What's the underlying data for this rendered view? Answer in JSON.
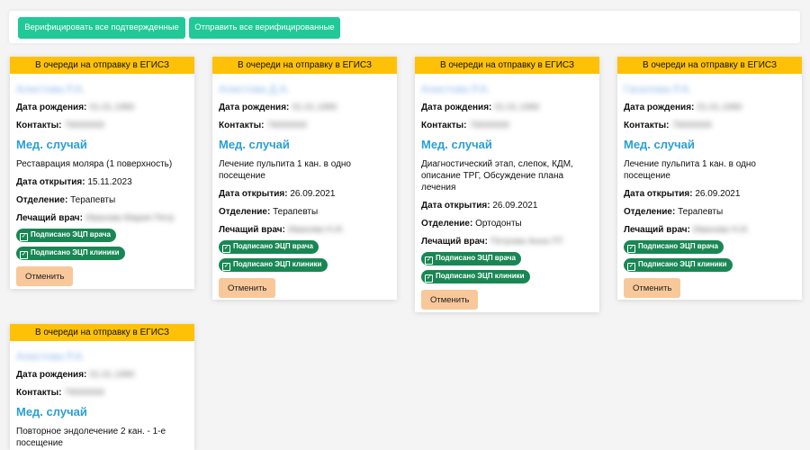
{
  "toolbar": {
    "verify_all_label": "Верифицировать все подтвержденные",
    "send_all_label": "Отправить все верифицированные"
  },
  "labels": {
    "birth_date": "Дата рождения:",
    "contacts": "Контакты:",
    "med_case": "Мед. случай",
    "open_date": "Дата открытия:",
    "department": "Отделение:",
    "doctor": "Лечащий врач:",
    "signed_doctor": "Подписано ЭЦП врача",
    "signed_clinic": "Подписано ЭЦП клиники",
    "cancel": "Отменить"
  },
  "colors": {
    "header": "#ffc107",
    "toolbar_button": "#20c997",
    "badge": "#198754",
    "cancel_button": "#f8c89a",
    "link": "#2a9fd6"
  },
  "cards": [
    {
      "status": "В очереди на отправку в ЕГИСЗ",
      "patient": "Алистова Р.А.",
      "birth_date": "01.01.1990",
      "contacts": "79000000",
      "procedure": "Реставрация моляра (1 поверхность)",
      "open_date": "15.11.2023",
      "department": "Терапевты",
      "doctor": "Иванова Мария Петр"
    },
    {
      "status": "В очереди на отправку в ЕГИСЗ",
      "patient": "Алистова Д.А.",
      "birth_date": "01.01.1990",
      "contacts": "79000000",
      "procedure": "Лечение пульпита 1 кан. в одно посещение",
      "open_date": "26.09.2021",
      "department": "Терапевты",
      "doctor": "Иванова Н.И."
    },
    {
      "status": "В очереди на отправку в ЕГИСЗ",
      "patient": "Алистова Р.А.",
      "birth_date": "01.01.1990",
      "contacts": "79000000",
      "procedure": "Диагностический этап, слепок, КДМ, описание ТРГ, Обсуждение плана лечения",
      "open_date": "26.09.2021",
      "department": "Ортодонты",
      "doctor": "Петрова Анна ПТ"
    },
    {
      "status": "В очереди на отправку в ЕГИСЗ",
      "patient": "Гасилова Р.А.",
      "birth_date": "01.01.1990",
      "contacts": "79000000",
      "procedure": "Лечение пульпита 1 кан. в одно посещение",
      "open_date": "26.09.2021",
      "department": "Терапевты",
      "doctor": "Иванова Н.И."
    },
    {
      "status": "В очереди на отправку в ЕГИСЗ",
      "patient": "Алистова Р.А.",
      "birth_date": "01.01.1990",
      "contacts": "79000000",
      "procedure": "Повторное эндолечение 2 кан. - 1-е посещение"
    }
  ]
}
